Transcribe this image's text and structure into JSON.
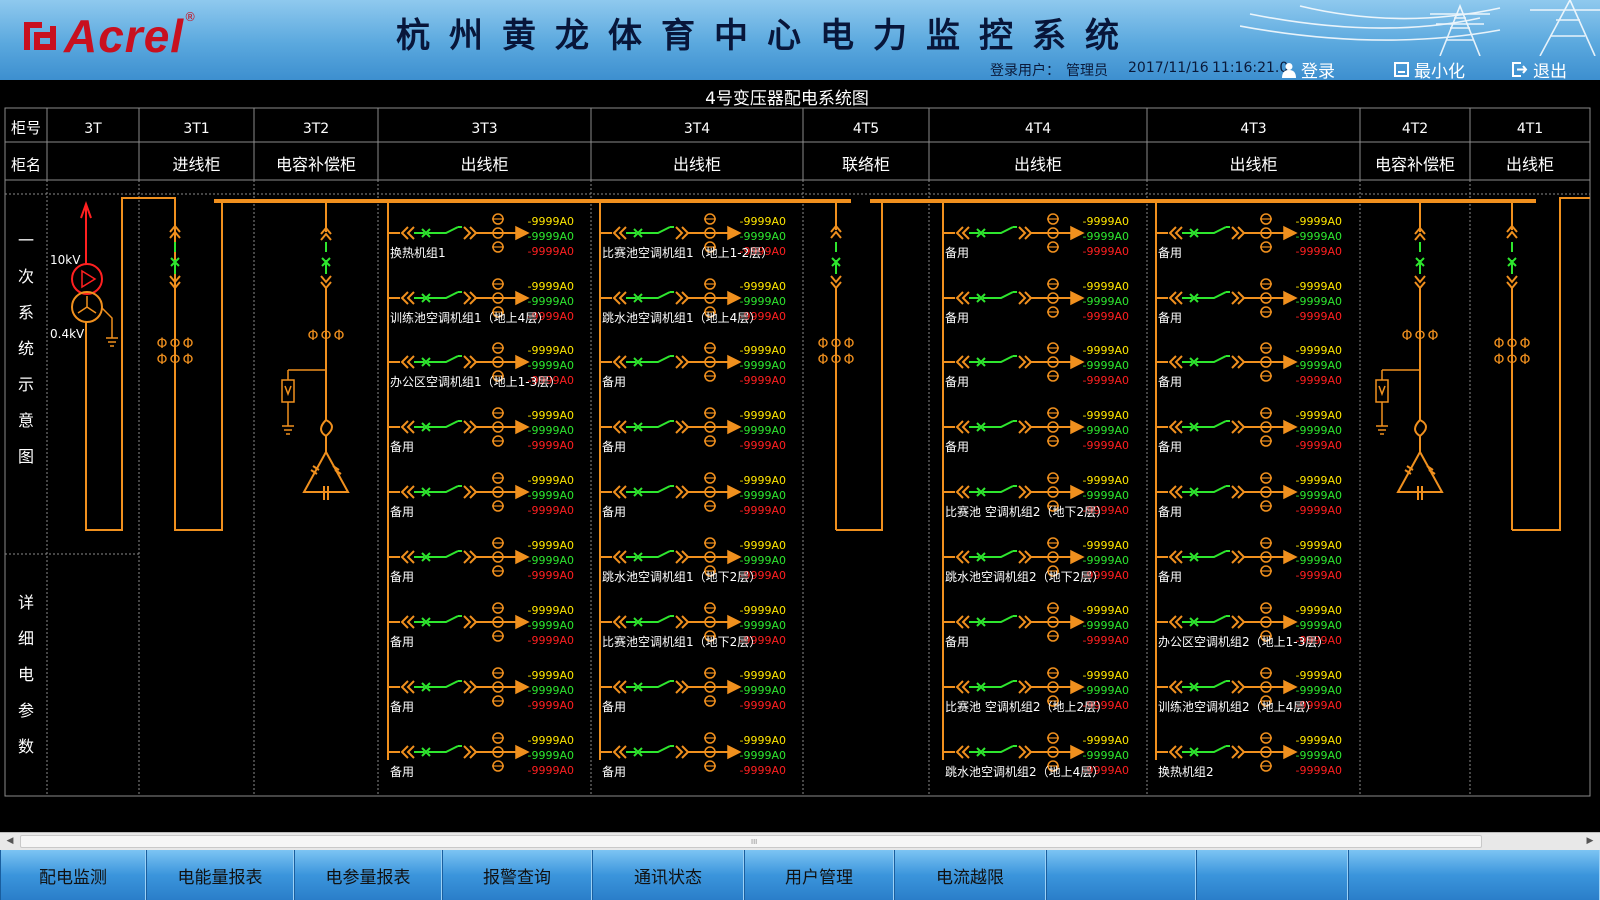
{
  "header": {
    "logo_text": "Acrel",
    "logo_reg": "®",
    "title": "杭州黄龙体育中心电力监控系统",
    "user_label": "登录用户：",
    "user_name": "管理员",
    "date": "2017/11/16",
    "time": "11:16:21.0",
    "login_btn": "登录",
    "minimize_btn": "最小化",
    "exit_btn": "退出"
  },
  "diagram": {
    "title": "4号变压器配电系统图",
    "row_label_no": "柜号",
    "row_label_name": "柜名",
    "side_label_1": "一次系统示意图",
    "side_label_2": "详细电参数",
    "voltage_high": "10kV",
    "voltage_low": "0.4kV",
    "meter_value": "-9999A0",
    "cabinets": [
      {
        "no": "3T",
        "name": ""
      },
      {
        "no": "3T1",
        "name": "进线柜"
      },
      {
        "no": "3T2",
        "name": "电容补偿柜"
      },
      {
        "no": "3T3",
        "name": "出线柜",
        "feeders": [
          "换热机组1",
          "训练池空调机组1（地上4层）",
          "办公区空调机组1（地上1-3层）",
          "备用",
          "备用",
          "备用",
          "备用",
          "备用",
          "备用"
        ]
      },
      {
        "no": "3T4",
        "name": "出线柜",
        "feeders": [
          "比赛池空调机组1（地上1-2层）",
          "跳水池空调机组1（地上4层）",
          "备用",
          "备用",
          "备用",
          "跳水池空调机组1（地下2层）",
          "比赛池空调机组1（地下2层）",
          "备用",
          "备用"
        ]
      },
      {
        "no": "4T5",
        "name": "联络柜"
      },
      {
        "no": "4T4",
        "name": "出线柜",
        "feeders": [
          "备用",
          "备用",
          "备用",
          "备用",
          "比赛池 空调机组2（地下2层）",
          "跳水池空调机组2（地下2层）",
          "备用",
          "比赛池 空调机组2（地上2层）",
          "跳水池空调机组2（地上4层）"
        ]
      },
      {
        "no": "4T3",
        "name": "出线柜",
        "feeders": [
          "备用",
          "备用",
          "备用",
          "备用",
          "备用",
          "备用",
          "办公区空调机组2（地上1-3层）",
          "训练池空调机组2（地上4层）",
          "换热机组2"
        ]
      },
      {
        "no": "4T2",
        "name": "电容补偿柜"
      },
      {
        "no": "4T1",
        "name": "出线柜"
      }
    ]
  },
  "scrollbar": {
    "grip": "III"
  },
  "nav": {
    "items": [
      "配电监测",
      "电能量报表",
      "电参量报表",
      "报警查询",
      "通讯状态",
      "用户管理",
      "电流越限",
      "",
      "",
      ""
    ]
  },
  "colors": {
    "orange": "#f0901e",
    "green": "#2ee62e",
    "yellow": "#ffe600",
    "red": "#ff2020",
    "grid": "#8a8a8a"
  }
}
